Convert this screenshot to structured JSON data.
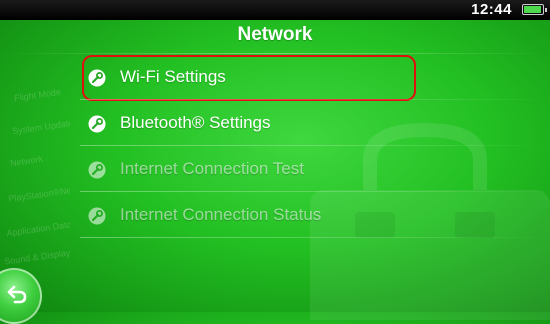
{
  "status": {
    "clock": "12:44"
  },
  "header": {
    "title": "Network"
  },
  "menu": [
    {
      "label": "Wi-Fi Settings",
      "icon": "wrench-icon",
      "enabled": true
    },
    {
      "label": "Bluetooth® Settings",
      "icon": "wrench-icon",
      "enabled": true
    },
    {
      "label": "Internet Connection Test",
      "icon": "wrench-icon",
      "enabled": false
    },
    {
      "label": "Internet Connection Status",
      "icon": "wrench-icon",
      "enabled": false
    }
  ],
  "background_menu": [
    "Flight Mode",
    "System Update",
    "Network",
    "PlayStation®Network",
    "Application Data Management",
    "Sound & Display"
  ],
  "highlight": {
    "target": "Wi-Fi Settings",
    "color": "#e01010"
  },
  "colors": {
    "background": "#22bf22",
    "text": "#ffffff"
  }
}
